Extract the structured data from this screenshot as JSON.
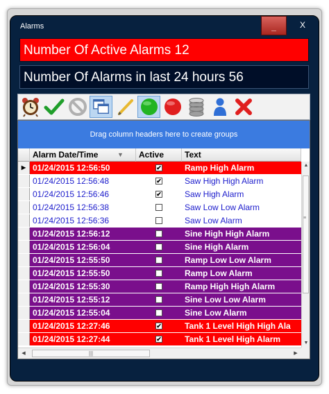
{
  "window": {
    "title": "Alarms",
    "minimize_label": "_",
    "close_label": "X"
  },
  "banners": {
    "active": "Number Of Active Alarms 12",
    "last24": "Number Of Alarms in last 24 hours 56"
  },
  "toolbar": {
    "buttons": [
      {
        "icon": "alarm-clock-icon"
      },
      {
        "icon": "checkmark-icon"
      },
      {
        "icon": "no-entry-icon"
      },
      {
        "icon": "copy-windows-icon"
      },
      {
        "icon": "pencil-icon"
      },
      {
        "icon": "green-circle-icon"
      },
      {
        "icon": "red-circle-icon"
      },
      {
        "icon": "database-icon"
      },
      {
        "icon": "user-icon"
      },
      {
        "icon": "delete-x-icon"
      }
    ]
  },
  "grid": {
    "group_panel_text": "Drag column headers here to create groups",
    "headers": {
      "date": "Alarm Date/Time",
      "active": "Active",
      "text": "Text"
    },
    "rows": [
      {
        "date": "01/24/2015 12:56:50",
        "active": true,
        "text": "Ramp High Alarm",
        "bg": "#ff0000",
        "fg": "#ffffff",
        "bold": true
      },
      {
        "date": "01/24/2015 12:56:48",
        "active": true,
        "text": "Saw High High Alarm",
        "bg": "#ffffff",
        "fg": "#1c1ccc",
        "bold": false
      },
      {
        "date": "01/24/2015 12:56:46",
        "active": true,
        "text": "Saw High Alarm",
        "bg": "#ffffff",
        "fg": "#1c1ccc",
        "bold": false
      },
      {
        "date": "01/24/2015 12:56:38",
        "active": false,
        "text": "Saw Low Low Alarm",
        "bg": "#ffffff",
        "fg": "#1c1ccc",
        "bold": false
      },
      {
        "date": "01/24/2015 12:56:36",
        "active": false,
        "text": "Saw Low Alarm",
        "bg": "#ffffff",
        "fg": "#1c1ccc",
        "bold": false
      },
      {
        "date": "01/24/2015 12:56:12",
        "active": false,
        "text": "Sine High High Alarm",
        "bg": "#7a0f8c",
        "fg": "#ffffff",
        "bold": true
      },
      {
        "date": "01/24/2015 12:56:04",
        "active": false,
        "text": "Sine High Alarm",
        "bg": "#7a0f8c",
        "fg": "#ffffff",
        "bold": true
      },
      {
        "date": "01/24/2015 12:55:50",
        "active": false,
        "text": "Ramp Low Low Alarm",
        "bg": "#7a0f8c",
        "fg": "#ffffff",
        "bold": true
      },
      {
        "date": "01/24/2015 12:55:50",
        "active": false,
        "text": "Ramp Low Alarm",
        "bg": "#7a0f8c",
        "fg": "#ffffff",
        "bold": true
      },
      {
        "date": "01/24/2015 12:55:30",
        "active": false,
        "text": "Ramp High High Alarm",
        "bg": "#7a0f8c",
        "fg": "#ffffff",
        "bold": true
      },
      {
        "date": "01/24/2015 12:55:12",
        "active": false,
        "text": "Sine Low Low Alarm",
        "bg": "#7a0f8c",
        "fg": "#ffffff",
        "bold": true
      },
      {
        "date": "01/24/2015 12:55:04",
        "active": false,
        "text": "Sine Low Alarm",
        "bg": "#7a0f8c",
        "fg": "#ffffff",
        "bold": true
      },
      {
        "date": "01/24/2015 12:27:46",
        "active": true,
        "text": "Tank 1 Level High High Ala",
        "bg": "#ff0000",
        "fg": "#ffffff",
        "bold": true
      },
      {
        "date": "01/24/2015 12:27:44",
        "active": true,
        "text": "Tank 1 Level High Alarm",
        "bg": "#ff0000",
        "fg": "#ffffff",
        "bold": true
      }
    ],
    "current_row_indicator": "▶"
  },
  "colors": {
    "window_bg": "#07213f",
    "group_panel": "#3b7be0",
    "active_alarm": "#ff0000",
    "inactive_alarm": "#7a0f8c",
    "acked_text": "#1c1ccc"
  }
}
